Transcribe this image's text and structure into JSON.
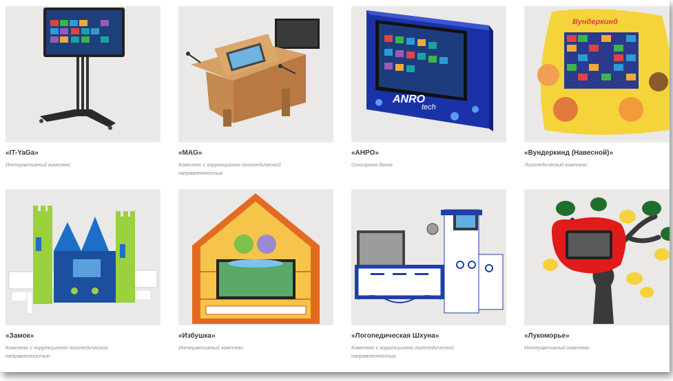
{
  "products": [
    {
      "title": "«IT-YaGa»",
      "subtitle": "Интерактивный комплекс",
      "image": "interactive-display-on-stand"
    },
    {
      "title": "«MAG»",
      "subtitle": "Комплекс с коррекционно логопедической направленностью",
      "image": "speech-therapy-desk-with-screen"
    },
    {
      "title": "«АНРО»",
      "subtitle": "Сенсорная доска",
      "image": "blue-touch-board",
      "brand": "ANRO tech"
    },
    {
      "title": "«Вундеркинд (Навесной)»",
      "subtitle": "Логопедический комплекс",
      "image": "wall-mounted-game-panel",
      "brand": "Вундеркинд"
    },
    {
      "title": "«Замок»",
      "subtitle": "Комплекс с коррекционно логопедической направленностью",
      "image": "castle-complex"
    },
    {
      "title": "«Избушка»",
      "subtitle": "Интерактивный комплекс",
      "image": "hut-complex"
    },
    {
      "title": "«Логопедическая Шхуна»",
      "subtitle": "Комплекс с коррекционно логопедической направленностью",
      "image": "ship-complex"
    },
    {
      "title": "«Лукоморье»",
      "subtitle": "Интерактивный комплекс",
      "image": "tree-complex"
    }
  ]
}
